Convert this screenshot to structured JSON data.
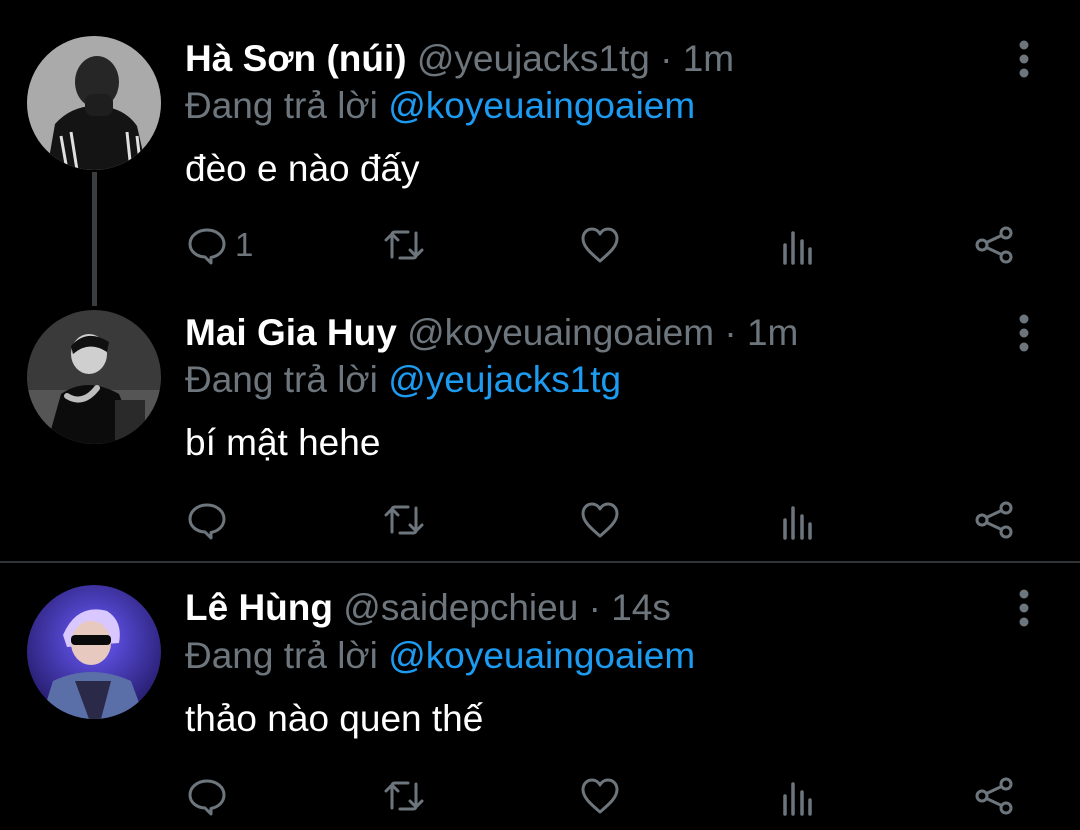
{
  "tweets": [
    {
      "name": "Hà Sơn (núi)",
      "handle": "@yeujacks1tg",
      "separator": "·",
      "time": "1m",
      "reply_prefix": "Đang trả lời",
      "reply_to": "@koyeuaingoaiem",
      "text": "đèo e nào đấy",
      "reply_count": "1"
    },
    {
      "name": "Mai Gia Huy",
      "handle": "@koyeuaingoaiem",
      "separator": "·",
      "time": "1m",
      "reply_prefix": "Đang trả lời",
      "reply_to": "@yeujacks1tg",
      "text": "bí mật hehe",
      "reply_count": ""
    },
    {
      "name": "Lê Hùng",
      "handle": "@saidepchieu",
      "separator": "·",
      "time": "14s",
      "reply_prefix": "Đang trả lời",
      "reply_to": "@koyeuaingoaiem",
      "text": "thảo nào quen thế",
      "reply_count": ""
    }
  ],
  "icons": {
    "reply": "reply-icon",
    "retweet": "retweet-icon",
    "like": "like-icon",
    "analytics": "analytics-icon",
    "share": "share-icon",
    "more": "more-icon"
  },
  "colors": {
    "background": "#000000",
    "name": "#ffffff",
    "muted": "#6e767d",
    "mention": "#1d9bf0",
    "divider": "#2f3336"
  }
}
